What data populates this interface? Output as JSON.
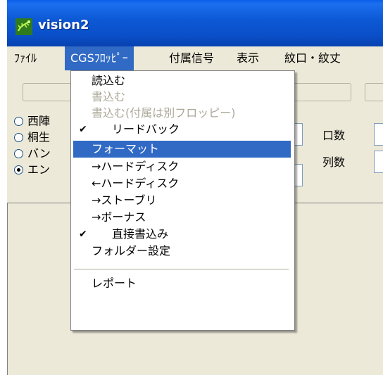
{
  "window": {
    "title": "vision2",
    "app_icon": "lizard-icon"
  },
  "menubar": {
    "items": [
      {
        "label": "ﾌｧｲﾙ"
      },
      {
        "label": "CGSﾌﾛｯﾋﾟｰ"
      },
      {
        "label": "付属信号"
      },
      {
        "label": "表示"
      },
      {
        "label": "紋口・紋丈"
      }
    ]
  },
  "form": {
    "radios": [
      {
        "label": "西陣",
        "checked": false
      },
      {
        "label": "桐生",
        "checked": false
      },
      {
        "label": "バン",
        "checked": false
      },
      {
        "label": "エン",
        "checked": true
      }
    ],
    "labels": {
      "kuchi": "口数",
      "retsu": "列数"
    }
  },
  "dropdown": {
    "items": [
      {
        "label": "読込む",
        "enabled": true,
        "checked": false,
        "highlighted": false
      },
      {
        "label": "書込む",
        "enabled": false,
        "checked": false,
        "highlighted": false
      },
      {
        "label": "書込む(付属は別フロッピー)",
        "enabled": false,
        "checked": false,
        "highlighted": false
      },
      {
        "label": "リードバック",
        "enabled": true,
        "checked": true,
        "highlighted": false
      },
      {
        "label": "フォーマット",
        "enabled": true,
        "checked": false,
        "highlighted": true
      },
      {
        "label": "→ハードディスク",
        "enabled": true,
        "checked": false,
        "highlighted": false
      },
      {
        "label": "←ハードディスク",
        "enabled": true,
        "checked": false,
        "highlighted": false
      },
      {
        "label": "→ストーブリ",
        "enabled": true,
        "checked": false,
        "highlighted": false
      },
      {
        "label": "→ボーナス",
        "enabled": true,
        "checked": false,
        "highlighted": false
      },
      {
        "label": "直接書込み",
        "enabled": true,
        "checked": true,
        "highlighted": false
      },
      {
        "label": "フォルダー設定",
        "enabled": true,
        "checked": false,
        "highlighted": false
      },
      {
        "label": "レポート",
        "enabled": true,
        "checked": false,
        "highlighted": false
      }
    ],
    "check_glyph": "✔"
  },
  "colors": {
    "titlebar": "#0a5ee8",
    "highlight": "#316ac5",
    "disabled_text": "#aca899",
    "face": "#ece9d8"
  }
}
